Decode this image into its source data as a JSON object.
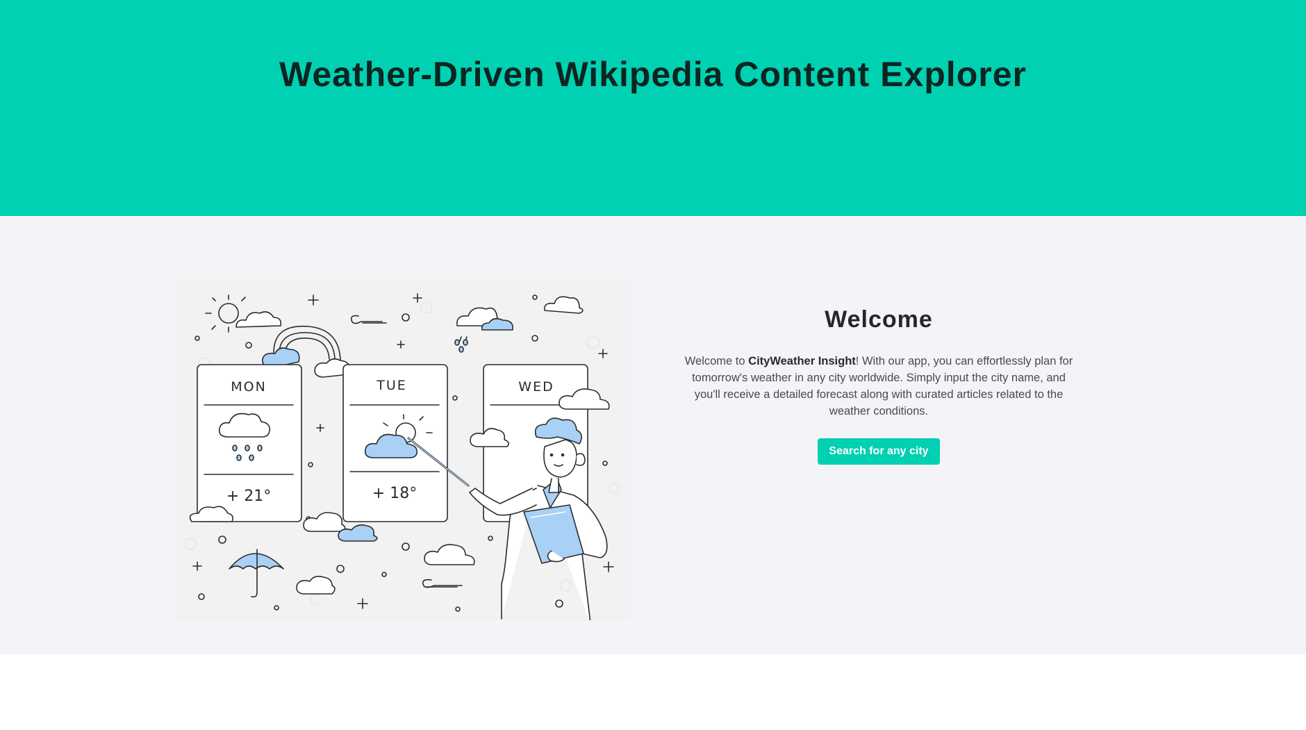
{
  "header": {
    "title": "Weather-Driven Wikipedia Content Explorer"
  },
  "illustration": {
    "days": [
      {
        "label": "MON",
        "temp": "+ 21°",
        "icon": "rain-cloud-icon"
      },
      {
        "label": "TUE",
        "temp": "+ 18°",
        "icon": "sun-cloud-icon"
      },
      {
        "label": "WED",
        "temp": "",
        "icon": "cloud-icon"
      }
    ]
  },
  "welcome": {
    "heading": "Welcome",
    "intro_before": "Welcome to ",
    "brand": "CityWeather Insight",
    "intro_after": "! With our app, you can effortlessly plan for tomorrow's weather in any city worldwide. Simply input the city name, and you'll receive a detailed forecast along with curated articles related to the weather conditions.",
    "button_label": "Search for any city"
  },
  "colors": {
    "accent": "#00d1b2",
    "background": "#f4f3f8",
    "cloud_fill": "#a9d0f5"
  }
}
